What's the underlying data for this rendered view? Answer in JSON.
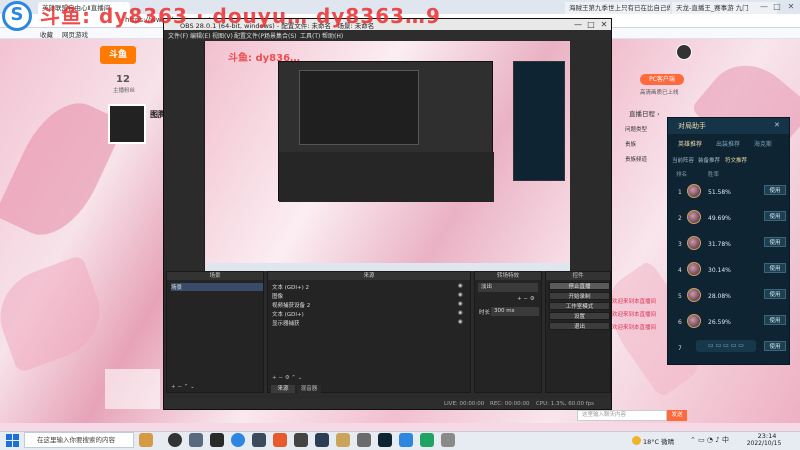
{
  "browser": {
    "tabs": [
      {
        "label": "英雄联盟自由心Ⅱ直播间"
      },
      {
        "label": "海贼王第九季世上只有已在比自己做 贸易"
      },
      {
        "label": "天龙-直播王_赛事游 九门"
      }
    ],
    "url": "https://www.douyu.com/",
    "window_controls": [
      "—",
      "□",
      "✕"
    ],
    "bookmarks": [
      "收藏",
      "网页游戏",
      "一",
      "一",
      "一"
    ]
  },
  "watermark": {
    "text": "斗鱼: dy8363  ·  douyu…  dy8363…9",
    "small": "斗鱼: dy836…"
  },
  "douyu": {
    "logo": "斗鱼",
    "anchor_level": "12",
    "anchor_level_label": "主播粉丝",
    "anchor_name": "图腾",
    "follow_button": "PC客户端",
    "follow_sub": "高清画质已上线",
    "live_rank": "直播日程 ›",
    "side_texts": [
      "问题类型",
      "贵族",
      "贵族频道",
      "流量",
      "欢迎来到本直播间",
      "欢迎来到本直播间",
      "欢迎来到本直播间"
    ]
  },
  "obs": {
    "title": "OBS 28.0.1 (64-bit, windows) - 配置文件: 未命名 - 场景: 未命名",
    "menu": [
      "文件(F)",
      "编辑(E)",
      "视图(V)",
      "配置文件(P)",
      "场景集合(S)",
      "工具(T)",
      "帮助(H)"
    ],
    "panels": {
      "scenes": {
        "title": "场景",
        "items": [
          "场景"
        ]
      },
      "sources": {
        "title": "来源",
        "items": [
          "文本 (GDI+) 2",
          "图像",
          "视频捕获设备 2",
          "文本 (GDI+)",
          "显示器捕获"
        ]
      },
      "mixer": {
        "title": "转场特效",
        "transition": "淡出",
        "duration_label": "时长",
        "duration": "300 ms"
      },
      "controls": {
        "title": "控件",
        "buttons": [
          "停止直播",
          "开始录制",
          "工作室模式",
          "设置",
          "退出"
        ]
      }
    },
    "bottom_tabs": [
      "来源",
      "混音器"
    ],
    "status": {
      "live": "LIVE: 00:00:00",
      "rec": "REC: 00:00:00",
      "cpu": "CPU: 1.3%, 60.00 fps"
    }
  },
  "helper": {
    "title": "对局助手",
    "tabs": [
      "英雄推荐",
      "出装推荐",
      "海克斯"
    ],
    "subtabs": [
      "当前阵容",
      "装备推荐",
      "符文推荐"
    ],
    "col_headers": [
      "排名",
      "胜率"
    ],
    "use_label": "使用",
    "rows": [
      {
        "rank": "1",
        "rate": "51.58%"
      },
      {
        "rank": "2",
        "rate": "49.69%"
      },
      {
        "rank": "3",
        "rate": "31.78%"
      },
      {
        "rank": "4",
        "rate": "30.14%"
      },
      {
        "rank": "5",
        "rate": "28.08%"
      },
      {
        "rank": "6",
        "rate": "26.59%"
      },
      {
        "rank": "7",
        "rate": ""
      }
    ]
  },
  "chat": {
    "placeholder": "这里输入聊天内容",
    "send": "发送"
  },
  "taskbar": {
    "search_placeholder": "在这里输入你要搜索的内容",
    "weather": "18°C 微晴",
    "time": "23:14",
    "date": "2022/10/15"
  },
  "colors": {
    "accent": "#ff6a3d",
    "obs_bg": "#2b2b2b",
    "helper_bg": "#0e2433",
    "watermark": "#eb2d2d"
  }
}
